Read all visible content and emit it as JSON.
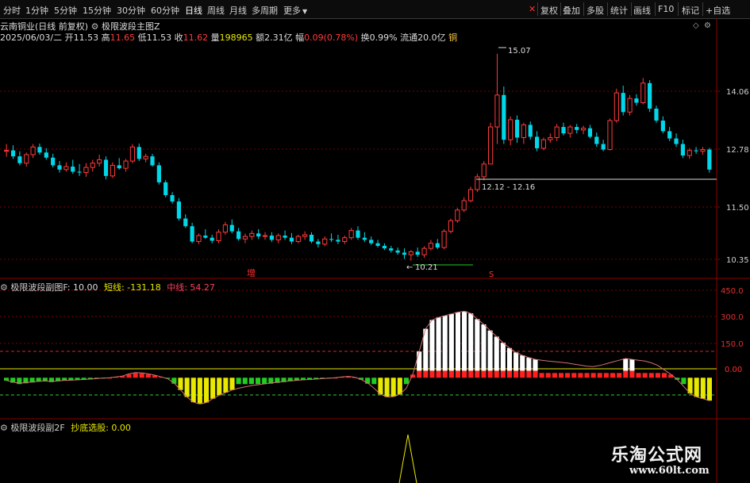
{
  "toolbar": {
    "left": [
      "分时",
      "1分钟",
      "5分钟",
      "15分钟",
      "30分钟",
      "60分钟",
      "日线",
      "周线",
      "月线",
      "多周期",
      "更多"
    ],
    "right": [
      "复权",
      "叠加",
      "多股",
      "统计",
      "画线",
      "F10",
      "标记",
      "+自选"
    ]
  },
  "info": {
    "name": "云南铜业",
    "period": "(日线 前复权)",
    "formula": "极限波段主图Z",
    "date": "2025/06/03/二",
    "open_label": "开",
    "open": "11.53",
    "high_label": "高",
    "high": "11.65",
    "low_label": "低",
    "low": "11.53",
    "close_label": "收",
    "close": "11.62",
    "vol_label": "量",
    "vol": "198965",
    "amt_label": "额",
    "amt": "2.31亿",
    "chg_label": "幅",
    "chg": "0.09(0.78%)",
    "turn_label": "换",
    "turn": "0.99%",
    "float_label": "流通",
    "float": "20.0亿",
    "extra": "铜"
  },
  "main_chart": {
    "y_ticks": [
      "14.06",
      "12.78",
      "11.50",
      "10.35"
    ],
    "annotations": {
      "high": "15.07",
      "range": "12.12 - 12.16",
      "low": "10.21",
      "zeng": "增",
      "s": "S"
    }
  },
  "sub1": {
    "title": "极限波段副图F",
    "f_label": ": 10.00",
    "short_label": "短线: -131.18",
    "mid_label": "中线: 54.27",
    "y_ticks": [
      "450.0",
      "300.0",
      "150.0",
      "0.00"
    ]
  },
  "sub2": {
    "title": "极限波段副2F",
    "label": "抄底选股: 0.00"
  },
  "watermark": {
    "cn": "乐淘公式网",
    "url": "www.60lt.com"
  },
  "chart_data": {
    "type": "candlestick",
    "candles": [
      [
        12.78,
        12.95,
        12.65,
        12.8
      ],
      [
        12.8,
        12.92,
        12.6,
        12.66
      ],
      [
        12.66,
        12.78,
        12.45,
        12.5
      ],
      [
        12.5,
        12.75,
        12.42,
        12.7
      ],
      [
        12.7,
        12.95,
        12.62,
        12.88
      ],
      [
        12.88,
        12.96,
        12.7,
        12.75
      ],
      [
        12.75,
        12.85,
        12.58,
        12.63
      ],
      [
        12.63,
        12.72,
        12.4,
        12.45
      ],
      [
        12.45,
        12.55,
        12.28,
        12.35
      ],
      [
        12.35,
        12.52,
        12.3,
        12.42
      ],
      [
        12.42,
        12.58,
        12.25,
        12.3
      ],
      [
        12.3,
        12.48,
        12.2,
        12.28
      ],
      [
        12.28,
        12.5,
        12.18,
        12.4
      ],
      [
        12.4,
        12.58,
        12.3,
        12.5
      ],
      [
        12.5,
        12.7,
        12.42,
        12.58
      ],
      [
        12.58,
        12.66,
        12.12,
        12.2
      ],
      [
        12.2,
        12.52,
        12.15,
        12.45
      ],
      [
        12.45,
        12.62,
        12.35,
        12.38
      ],
      [
        12.38,
        12.6,
        12.3,
        12.55
      ],
      [
        12.55,
        12.95,
        12.5,
        12.88
      ],
      [
        12.88,
        12.96,
        12.55,
        12.6
      ],
      [
        12.6,
        12.72,
        12.52,
        12.66
      ],
      [
        12.66,
        12.72,
        12.42,
        12.45
      ],
      [
        12.45,
        12.52,
        12.0,
        12.05
      ],
      [
        12.05,
        12.1,
        11.7,
        11.75
      ],
      [
        11.75,
        11.82,
        11.55,
        11.6
      ],
      [
        11.6,
        11.68,
        11.15,
        11.2
      ],
      [
        11.2,
        11.3,
        10.98,
        11.02
      ],
      [
        11.02,
        11.1,
        10.62,
        10.66
      ],
      [
        10.66,
        10.85,
        10.6,
        10.8
      ],
      [
        10.8,
        10.95,
        10.72,
        10.75
      ],
      [
        10.75,
        10.82,
        10.62,
        10.68
      ],
      [
        10.68,
        10.95,
        10.62,
        10.88
      ],
      [
        10.88,
        11.12,
        10.82,
        11.05
      ],
      [
        11.05,
        11.18,
        10.85,
        10.9
      ],
      [
        10.9,
        10.98,
        10.68,
        10.72
      ],
      [
        10.72,
        10.85,
        10.62,
        10.78
      ],
      [
        10.78,
        10.92,
        10.7,
        10.85
      ],
      [
        10.85,
        10.95,
        10.72,
        10.78
      ],
      [
        10.78,
        10.88,
        10.7,
        10.8
      ],
      [
        10.8,
        10.88,
        10.65,
        10.7
      ],
      [
        10.7,
        10.85,
        10.62,
        10.8
      ],
      [
        10.8,
        10.92,
        10.7,
        10.75
      ],
      [
        10.75,
        10.86,
        10.6,
        10.66
      ],
      [
        10.66,
        10.82,
        10.62,
        10.78
      ],
      [
        10.78,
        10.9,
        10.7,
        10.82
      ],
      [
        10.82,
        10.88,
        10.62,
        10.66
      ],
      [
        10.66,
        10.72,
        10.52,
        10.6
      ],
      [
        10.6,
        10.78,
        10.55,
        10.72
      ],
      [
        10.72,
        10.85,
        10.65,
        10.7
      ],
      [
        10.7,
        10.82,
        10.6,
        10.66
      ],
      [
        10.66,
        10.8,
        10.6,
        10.75
      ],
      [
        10.75,
        10.98,
        10.7,
        10.92
      ],
      [
        10.92,
        11.02,
        10.7,
        10.75
      ],
      [
        10.75,
        10.88,
        10.65,
        10.7
      ],
      [
        10.7,
        10.78,
        10.58,
        10.62
      ],
      [
        10.62,
        10.7,
        10.52,
        10.56
      ],
      [
        10.56,
        10.62,
        10.46,
        10.5
      ],
      [
        10.5,
        10.56,
        10.4,
        10.45
      ],
      [
        10.45,
        10.52,
        10.35,
        10.4
      ],
      [
        10.4,
        10.5,
        10.25,
        10.35
      ],
      [
        10.35,
        10.46,
        10.21,
        10.42
      ],
      [
        10.42,
        10.52,
        10.3,
        10.35
      ],
      [
        10.35,
        10.55,
        10.28,
        10.5
      ],
      [
        10.5,
        10.7,
        10.45,
        10.62
      ],
      [
        10.62,
        10.72,
        10.48,
        10.52
      ],
      [
        10.52,
        10.95,
        10.48,
        10.9
      ],
      [
        10.9,
        11.2,
        10.85,
        11.15
      ],
      [
        11.15,
        11.45,
        11.1,
        11.4
      ],
      [
        11.4,
        11.7,
        11.35,
        11.62
      ],
      [
        11.62,
        11.95,
        11.58,
        11.88
      ],
      [
        11.88,
        12.25,
        11.82,
        12.18
      ],
      [
        12.18,
        12.55,
        12.1,
        12.48
      ],
      [
        12.48,
        13.45,
        12.85,
        13.35
      ],
      [
        13.35,
        15.07,
        12.95,
        14.1
      ],
      [
        14.1,
        14.3,
        12.95,
        13.05
      ],
      [
        13.05,
        13.6,
        12.92,
        13.52
      ],
      [
        13.52,
        13.62,
        12.98,
        13.1
      ],
      [
        13.1,
        13.45,
        12.95,
        13.4
      ],
      [
        13.4,
        13.48,
        13.05,
        13.12
      ],
      [
        13.12,
        13.25,
        12.78,
        12.85
      ],
      [
        12.85,
        13.1,
        12.8,
        13.05
      ],
      [
        13.05,
        13.2,
        12.98,
        13.1
      ],
      [
        13.1,
        13.42,
        13.02,
        13.35
      ],
      [
        13.35,
        13.45,
        13.15,
        13.2
      ],
      [
        13.2,
        13.4,
        13.1,
        13.35
      ],
      [
        13.35,
        13.42,
        13.2,
        13.28
      ],
      [
        13.28,
        13.38,
        13.18,
        13.32
      ],
      [
        13.32,
        13.4,
        13.08,
        13.12
      ],
      [
        13.12,
        13.22,
        12.88,
        12.95
      ],
      [
        12.95,
        13.05,
        12.78,
        12.82
      ],
      [
        12.82,
        13.55,
        12.8,
        13.5
      ],
      [
        13.5,
        14.25,
        13.45,
        14.15
      ],
      [
        14.15,
        14.32,
        13.62,
        13.7
      ],
      [
        13.7,
        14.1,
        13.62,
        14.02
      ],
      [
        14.02,
        14.12,
        13.85,
        13.92
      ],
      [
        13.92,
        14.5,
        13.88,
        14.38
      ],
      [
        14.38,
        14.45,
        13.7,
        13.78
      ],
      [
        13.78,
        13.85,
        13.45,
        13.5
      ],
      [
        13.5,
        13.6,
        13.2,
        13.25
      ],
      [
        13.25,
        13.35,
        13.02,
        13.08
      ],
      [
        13.08,
        13.2,
        12.88,
        12.95
      ],
      [
        12.95,
        13.05,
        12.62,
        12.68
      ],
      [
        12.68,
        12.85,
        12.6,
        12.8
      ],
      [
        12.8,
        12.88,
        12.72,
        12.78
      ],
      [
        12.78,
        12.88,
        12.7,
        12.82
      ],
      [
        12.82,
        12.86,
        12.28,
        12.35
      ]
    ],
    "ylim": [
      10.0,
      15.4
    ],
    "sub1_ylim": [
      -230,
      500
    ],
    "short_line": [
      -15,
      -25,
      -32,
      -28,
      -24,
      -20,
      -18,
      -22,
      -18,
      -15,
      -14,
      -12,
      -10,
      -8,
      -5,
      -2,
      0,
      5,
      10,
      22,
      30,
      28,
      22,
      15,
      5,
      -5,
      -30,
      -70,
      -110,
      -140,
      -150,
      -142,
      -120,
      -100,
      -85,
      -70,
      -60,
      -52,
      -45,
      -40,
      -35,
      -30,
      -26,
      -22,
      -18,
      -15,
      -12,
      -10,
      -8,
      -5,
      -3,
      0,
      5,
      8,
      3,
      -10,
      -30,
      -60,
      -95,
      -110,
      -108,
      -95,
      -60,
      20,
      150,
      280,
      330,
      345,
      355,
      365,
      375,
      380,
      368,
      335,
      305,
      270,
      235,
      200,
      170,
      145,
      128,
      115,
      105,
      100,
      95,
      92,
      88,
      84,
      78,
      72,
      66,
      64,
      70,
      80,
      90,
      100,
      110,
      105,
      100,
      95,
      85,
      70,
      45,
      20,
      -10,
      -50,
      -90,
      -110,
      -120,
      -131
    ]
  }
}
